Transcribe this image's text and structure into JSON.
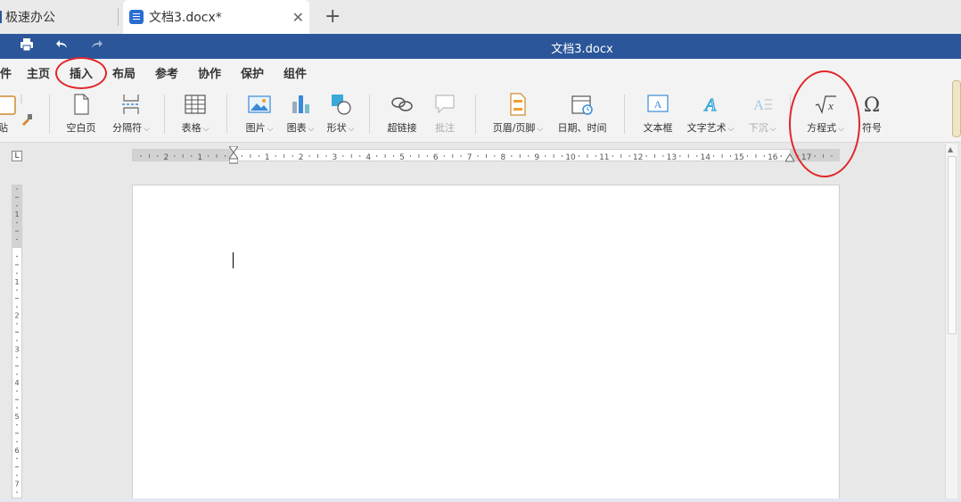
{
  "tabs": {
    "tab1_label": "极速办公",
    "tab2_label": "文档3.docx*",
    "close_glyph": "✕",
    "new_tab_glyph": "+"
  },
  "titlebar": {
    "title": "文档3.docx",
    "print_icon": "print-icon",
    "undo_icon": "undo-icon",
    "redo_icon": "redo-icon"
  },
  "menu": {
    "items": [
      "件",
      "主页",
      "插入",
      "布局",
      "参考",
      "协作",
      "保护",
      "组件"
    ],
    "active": "插入"
  },
  "ribbon": {
    "paste_label": "贴",
    "blank_page": "空白页",
    "page_break": "分隔符",
    "table": "表格",
    "image": "图片",
    "chart": "图表",
    "shape": "形状",
    "hyperlink": "超链接",
    "comment": "批注",
    "header_footer": "页眉/页脚",
    "datetime": "日期、时间",
    "textbox": "文本框",
    "textart": "文字艺术",
    "dropcap": "下沉",
    "equation": "方程式",
    "symbol": "符号"
  },
  "ruler": {
    "h_numbers": [
      "2",
      "1",
      "",
      "1",
      "2",
      "3",
      "4",
      "5",
      "6",
      "7",
      "8",
      "9",
      "10",
      "11",
      "12",
      "13",
      "14",
      "15",
      "16",
      "17"
    ],
    "v_numbers": [
      "1",
      "",
      "1",
      "2",
      "3",
      "4",
      "5",
      "6",
      "7"
    ],
    "tab_selector": "L"
  },
  "colors": {
    "accent": "#2b579a",
    "annotation": "#e0262b"
  }
}
